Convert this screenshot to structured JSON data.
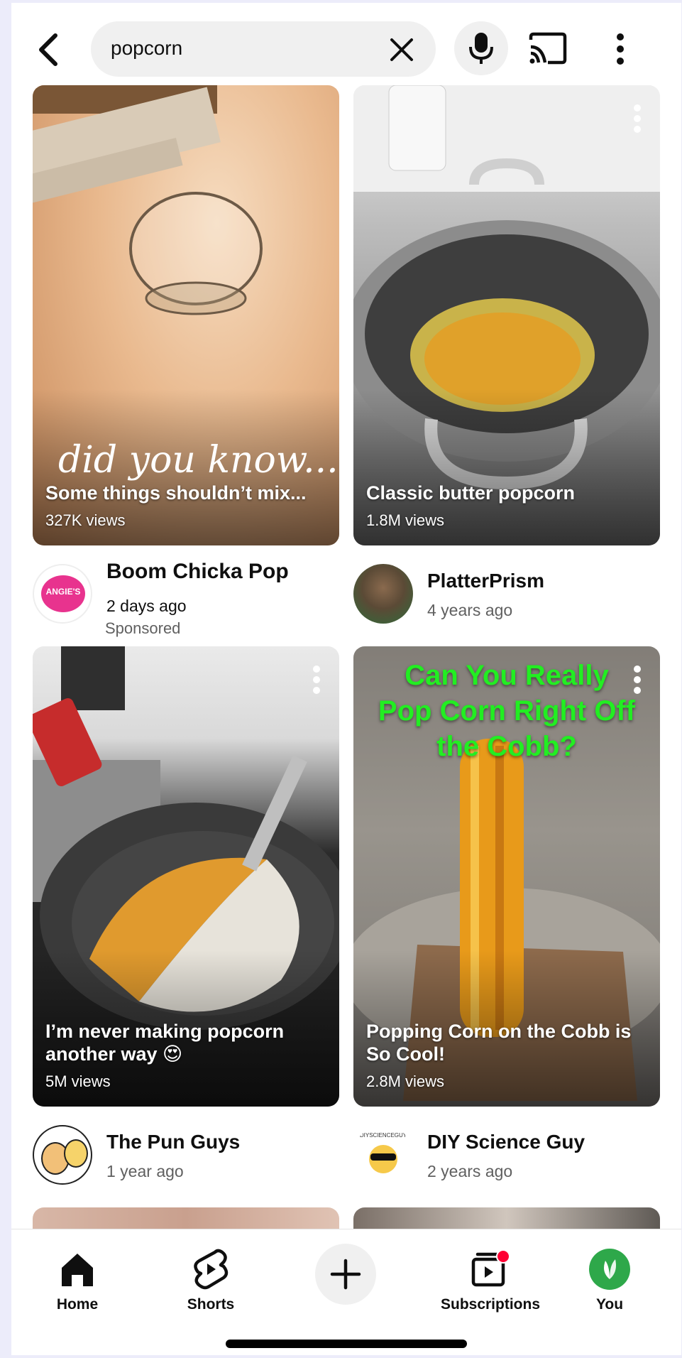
{
  "search": {
    "query": "popcorn"
  },
  "cards": [
    {
      "title": "Some things shouldn’t mix...",
      "overlay_text": "did you know...",
      "views": "327K views",
      "channel": "Boom Chicka Pop",
      "avatar_text": "ANGIE'S",
      "age": "2 days ago",
      "sponsored": "Sponsored"
    },
    {
      "title": "Classic butter popcorn",
      "views": "1.8M views",
      "channel": "PlatterPrism",
      "age": "4 years ago"
    },
    {
      "title": "I’m never making popcorn another way 😍",
      "views": "5M views",
      "channel": "The Pun Guys",
      "age": "1 year ago"
    },
    {
      "title": "Popping Corn on the Cobb is So Cool!",
      "overlay_text": "Can You Really Pop Corn Right Off the Cobb?",
      "views": "2.8M views",
      "channel": "DIY Science Guy",
      "avatar_text": "DIYSCIENCEGUY",
      "age": "2 years ago"
    }
  ],
  "nav": {
    "home": "Home",
    "shorts": "Shorts",
    "subscriptions": "Subscriptions",
    "you": "You"
  },
  "colors": {
    "accent_red": "#ff0033",
    "you_avatar_green": "#2ea84a",
    "overlay_green": "#22ee22"
  },
  "icons": {
    "back": "back-arrow-icon",
    "clear": "close-icon",
    "mic": "microphone-icon",
    "cast": "cast-icon",
    "more": "more-vertical-icon",
    "home": "home-icon",
    "shorts": "shorts-icon",
    "create": "plus-icon",
    "subscriptions": "subscriptions-icon"
  }
}
